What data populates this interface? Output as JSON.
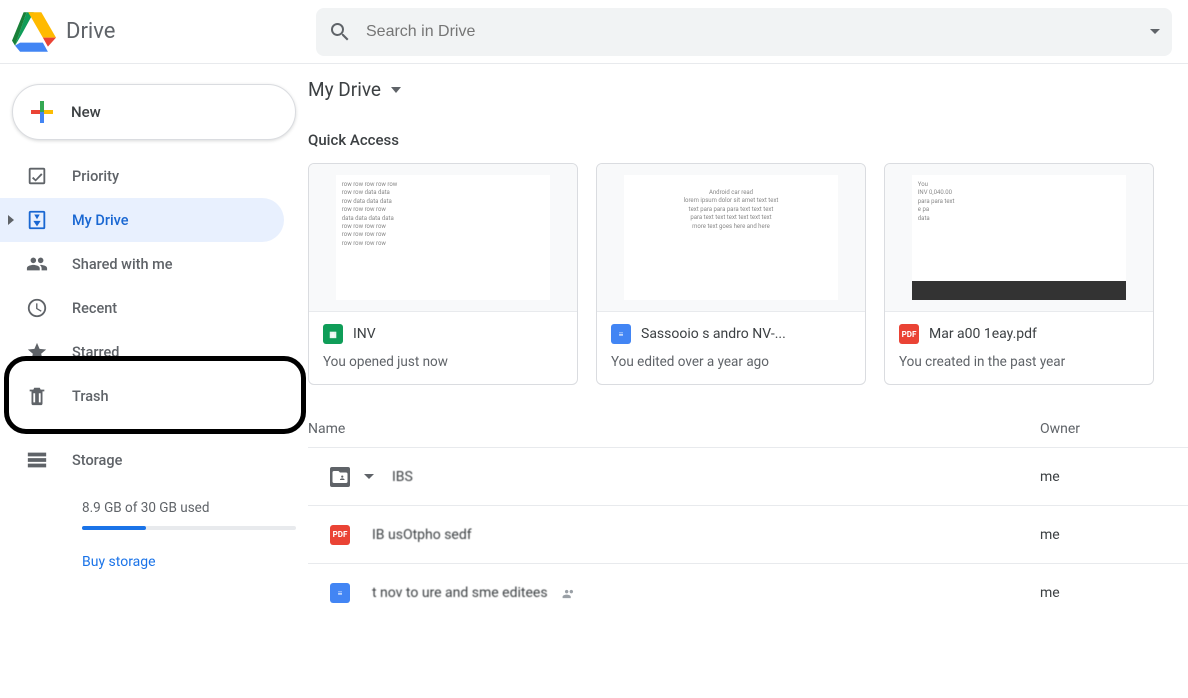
{
  "app": {
    "name": "Drive"
  },
  "search": {
    "placeholder": "Search in Drive"
  },
  "sidebar": {
    "new_label": "New",
    "items": [
      {
        "label": "Priority"
      },
      {
        "label": "My Drive"
      },
      {
        "label": "Shared with me"
      },
      {
        "label": "Recent"
      },
      {
        "label": "Starred"
      },
      {
        "label": "Trash"
      },
      {
        "label": "Storage"
      }
    ],
    "storage_text": "8.9 GB of 30 GB used",
    "buy_label": "Buy storage"
  },
  "main": {
    "location": "My Drive",
    "quick_access_title": "Quick Access",
    "quick_access": [
      {
        "name": "INV",
        "subtitle": "You opened just now",
        "type": "sheets"
      },
      {
        "name": "Sassooio s andro NV-...",
        "subtitle": "You edited over a year ago",
        "type": "docs"
      },
      {
        "name": "Mar a00 1eay.pdf",
        "subtitle": "You created in the past year",
        "type": "pdf"
      }
    ],
    "columns": {
      "name": "Name",
      "owner": "Owner"
    },
    "rows": [
      {
        "name": "IBS",
        "owner": "me",
        "type": "folder",
        "shared": true
      },
      {
        "name": "IB usOtpho   sedf",
        "owner": "me",
        "type": "pdf"
      },
      {
        "name": "t nov to    ure and    sme   editees",
        "owner": "me",
        "type": "docs",
        "shared": true
      }
    ]
  }
}
